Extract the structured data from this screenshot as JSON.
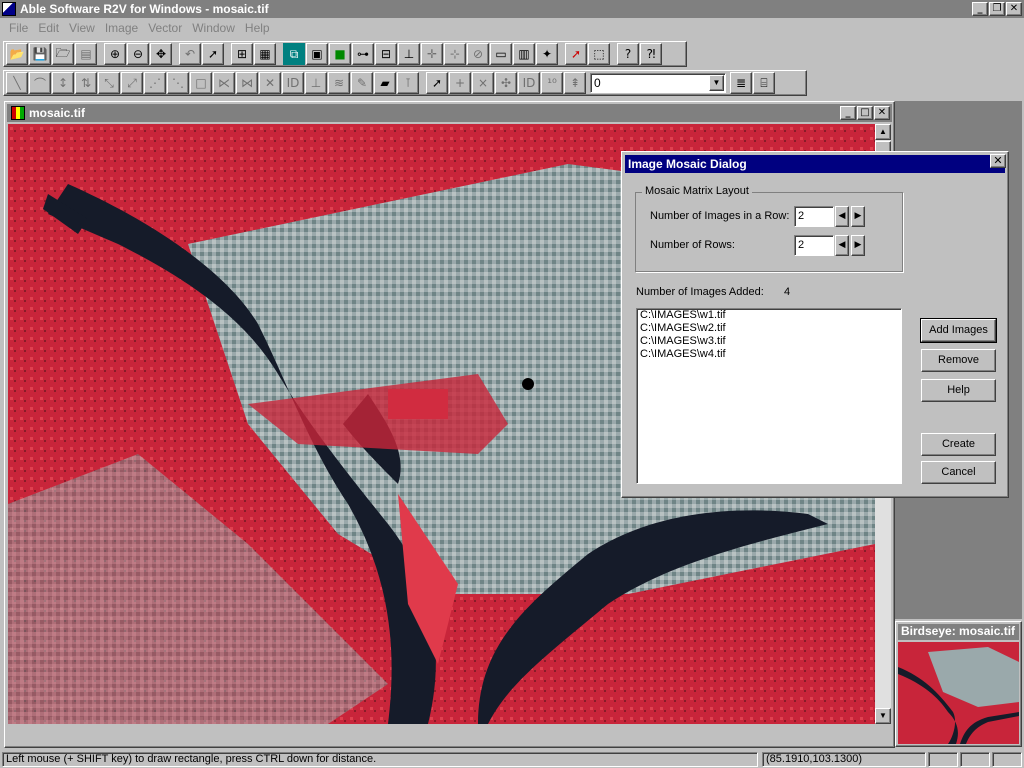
{
  "app": {
    "title": "Able Software R2V for Windows - mosaic.tif"
  },
  "menu": [
    "File",
    "Edit",
    "View",
    "Image",
    "Vector",
    "Window",
    "Help"
  ],
  "toolbar2": {
    "combo_value": "0"
  },
  "child": {
    "title": "mosaic.tif"
  },
  "birdseye": {
    "title": "Birdseye: mosaic.tif"
  },
  "dialog": {
    "title": "Image Mosaic Dialog",
    "group_label": "Mosaic Matrix Layout",
    "row_label": "Number of Images in a Row:",
    "row_value": "2",
    "rows_label": "Number of Rows:",
    "rows_value": "2",
    "added_label": "Number of Images Added:",
    "added_value": "4",
    "files": [
      "C:\\IMAGES\\w1.tif",
      "C:\\IMAGES\\w2.tif",
      "C:\\IMAGES\\w3.tif",
      "C:\\IMAGES\\w4.tif"
    ],
    "buttons": {
      "add": "Add Images",
      "remove": "Remove",
      "help": "Help",
      "create": "Create",
      "cancel": "Cancel"
    }
  },
  "status": {
    "message": "Left mouse (+ SHIFT key) to draw rectangle, press CTRL down for distance.",
    "coords": "(85.1910,103.1300)"
  },
  "colors": {
    "map_red": "#c8253a",
    "river": "#1a1f2e",
    "urban": "#8fa7a8",
    "title_active": "#000080",
    "title_inactive": "#808080"
  }
}
